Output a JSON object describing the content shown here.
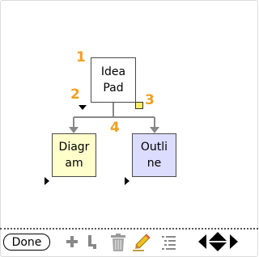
{
  "mindmap": {
    "root": {
      "lines": [
        "Idea",
        "Pad"
      ]
    },
    "children": [
      {
        "lines": [
          "Diagr",
          "am"
        ]
      },
      {
        "lines": [
          "Outli",
          "ne"
        ]
      }
    ],
    "callouts": [
      "1",
      "2",
      "3",
      "4"
    ],
    "colors": {
      "callout": "#f0a020",
      "diagram_fill": "#ffffcc",
      "outline_fill": "#dcdcff",
      "note": "#ffee66",
      "connector": "#888888"
    }
  },
  "toolbar": {
    "done_label": "Done",
    "icons": [
      "add-icon",
      "add-child-icon",
      "trash-icon",
      "pencil-icon",
      "outline-view-icon",
      "navigate-left-icon",
      "navigate-up-down-icon",
      "navigate-right-icon"
    ]
  }
}
